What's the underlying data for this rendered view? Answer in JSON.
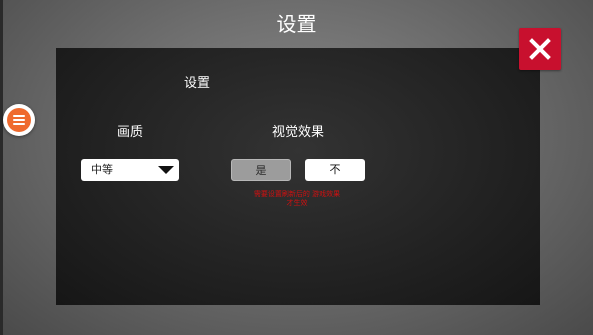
{
  "header": {
    "title": "设置"
  },
  "panel": {
    "heading": "设置",
    "quality": {
      "label": "画质",
      "selected": "中等"
    },
    "visual_effects": {
      "label": "视觉效果",
      "yes_label": "是",
      "no_label": "不"
    },
    "warning_text": "需要设置刷新后的 游戏效果才生效"
  },
  "icons": {
    "close": "close-icon",
    "menu": "hamburger-menu-icon",
    "dropdown": "caret-down-icon"
  },
  "colors": {
    "close_button": "#c8102e",
    "menu_button": "#ef6a2e",
    "warning": "#d01010"
  }
}
